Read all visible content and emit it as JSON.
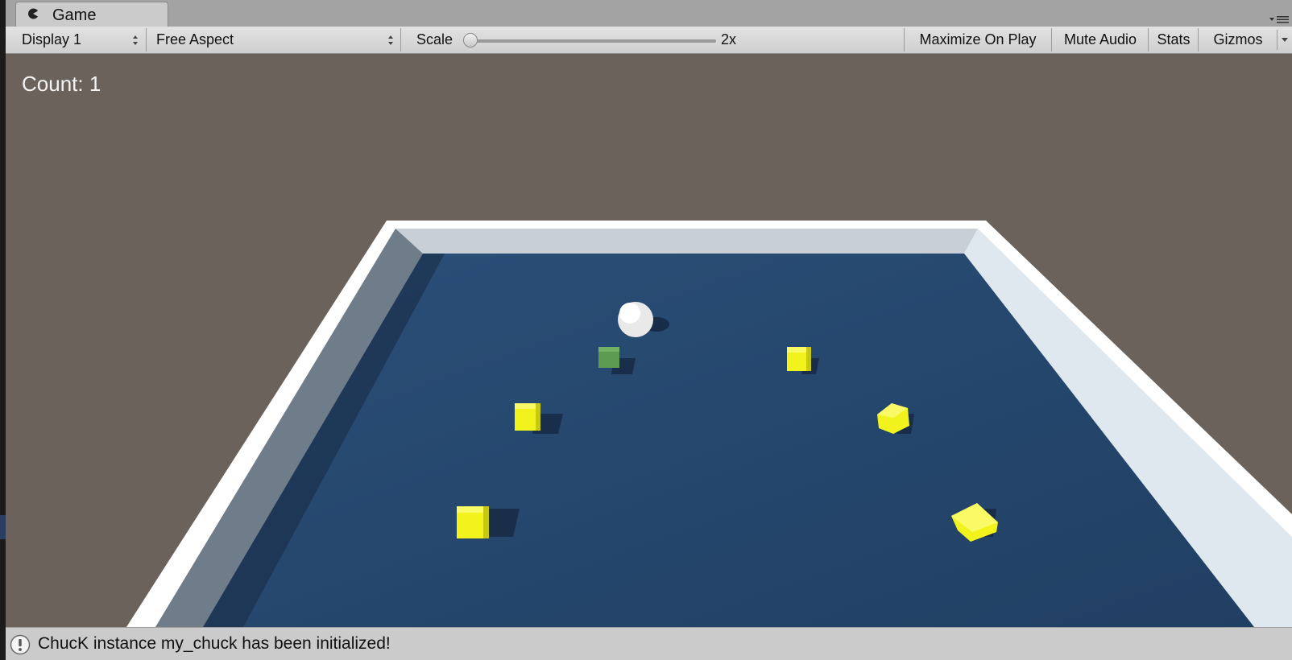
{
  "tab": {
    "title": "Game",
    "icon": "pacman-game-icon"
  },
  "toolbar": {
    "display_value": "Display 1",
    "aspect_value": "Free Aspect",
    "scale_label": "Scale",
    "scale_value": "2x",
    "scale_level": 0.0,
    "maximize_on_play": "Maximize On Play",
    "mute_audio": "Mute Audio",
    "stats": "Stats",
    "gizmos": "Gizmos"
  },
  "game": {
    "count_text": "Count: 1",
    "colors": {
      "background": "#6a625b",
      "floor": "#284b72",
      "wall": "#e8eef3",
      "pickup": "#f2f21c",
      "pickup_collected": "#5e9b52",
      "player": "#f0f0f0"
    },
    "pickups": [
      {
        "state": "collected"
      },
      {
        "state": "active"
      },
      {
        "state": "active"
      },
      {
        "state": "active"
      },
      {
        "state": "active"
      },
      {
        "state": "active"
      }
    ]
  },
  "status": {
    "icon": "info-icon",
    "message": "ChucK instance my_chuck has been initialized!"
  }
}
